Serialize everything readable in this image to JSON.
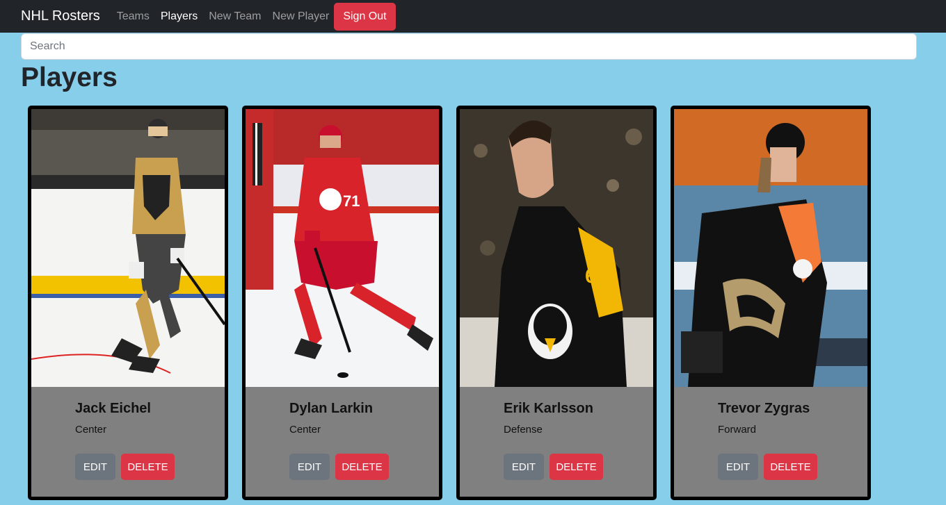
{
  "navbar": {
    "brand": "NHL Rosters",
    "links": [
      {
        "label": "Teams",
        "active": false
      },
      {
        "label": "Players",
        "active": true
      },
      {
        "label": "New Team",
        "active": false
      },
      {
        "label": "New Player",
        "active": false
      }
    ],
    "signout_label": "Sign Out"
  },
  "search": {
    "placeholder": "Search",
    "value": ""
  },
  "page_title": "Players",
  "players": [
    {
      "name": "Jack Eichel",
      "position": "Center",
      "edit_label": "EDIT",
      "delete_label": "DELETE",
      "jersey_number": ""
    },
    {
      "name": "Dylan Larkin",
      "position": "Center",
      "edit_label": "EDIT",
      "delete_label": "DELETE",
      "jersey_number": "71"
    },
    {
      "name": "Erik Karlsson",
      "position": "Defense",
      "edit_label": "EDIT",
      "delete_label": "DELETE",
      "jersey_number": "65"
    },
    {
      "name": "Trevor Zygras",
      "position": "Forward",
      "edit_label": "EDIT",
      "delete_label": "DELETE",
      "jersey_number": ""
    }
  ],
  "colors": {
    "background": "#87CEEB",
    "navbar": "#212529",
    "danger": "#dc3545",
    "secondary": "#6c757d",
    "card_body": "#808080"
  }
}
